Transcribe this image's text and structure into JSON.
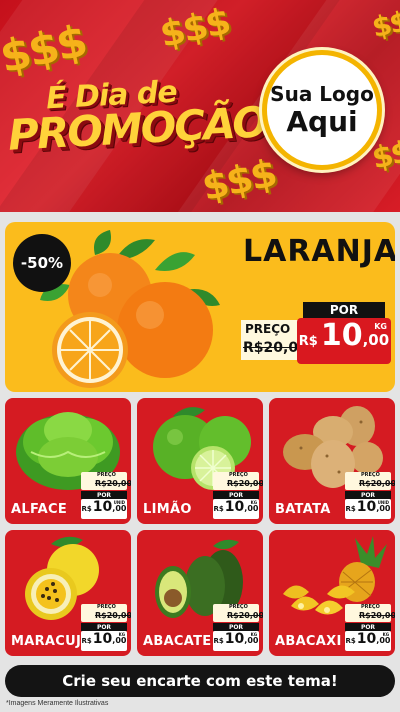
{
  "header": {
    "currency_symbol": "$$$",
    "headline_line1": "É Dia de",
    "headline_line2": "PROMOÇÃO",
    "logo_line1": "Sua Logo",
    "logo_line2": "Aqui"
  },
  "featured": {
    "discount": "-50%",
    "name": "LARANJA",
    "por_label": "POR",
    "old_label": "PREÇO",
    "old_price": "R$20,00",
    "currency": "R$",
    "price_int": "10",
    "price_dec": ",00",
    "unit": "KG",
    "icon": "orange"
  },
  "products": [
    {
      "name": "ALFACE",
      "old_label": "PREÇO",
      "old_price": "R$20,00",
      "por_label": "POR",
      "currency": "R$",
      "price_int": "10",
      "price_dec": ",00",
      "unit": "UNID",
      "icon": "lettuce"
    },
    {
      "name": "LIMÃO",
      "old_label": "PREÇO",
      "old_price": "R$20,00",
      "por_label": "POR",
      "currency": "R$",
      "price_int": "10",
      "price_dec": ",00",
      "unit": "KG",
      "icon": "lime"
    },
    {
      "name": "BATATA",
      "old_label": "PREÇO",
      "old_price": "R$20,00",
      "por_label": "POR",
      "currency": "R$",
      "price_int": "10",
      "price_dec": ",00",
      "unit": "UNID",
      "icon": "potato"
    },
    {
      "name": "MARACUJÁ",
      "old_label": "PREÇO",
      "old_price": "R$20,00",
      "por_label": "POR",
      "currency": "R$",
      "price_int": "10",
      "price_dec": ",00",
      "unit": "KG",
      "icon": "passion-fruit"
    },
    {
      "name": "ABACATE",
      "old_label": "PREÇO",
      "old_price": "R$20,00",
      "por_label": "POR",
      "currency": "R$",
      "price_int": "10",
      "price_dec": ",00",
      "unit": "KG",
      "icon": "avocado"
    },
    {
      "name": "ABACAXI",
      "old_label": "PREÇO",
      "old_price": "R$20,00",
      "por_label": "POR",
      "currency": "R$",
      "price_int": "10",
      "price_dec": ",00",
      "unit": "KG",
      "icon": "pineapple"
    }
  ],
  "cta_label": "Crie seu encarte com este tema!",
  "footnote": "*Imagens Meramente Ilustrativas",
  "colors": {
    "brand_red": "#d51b22",
    "promo_yellow": "#fbbc1c",
    "dark": "#141414"
  }
}
